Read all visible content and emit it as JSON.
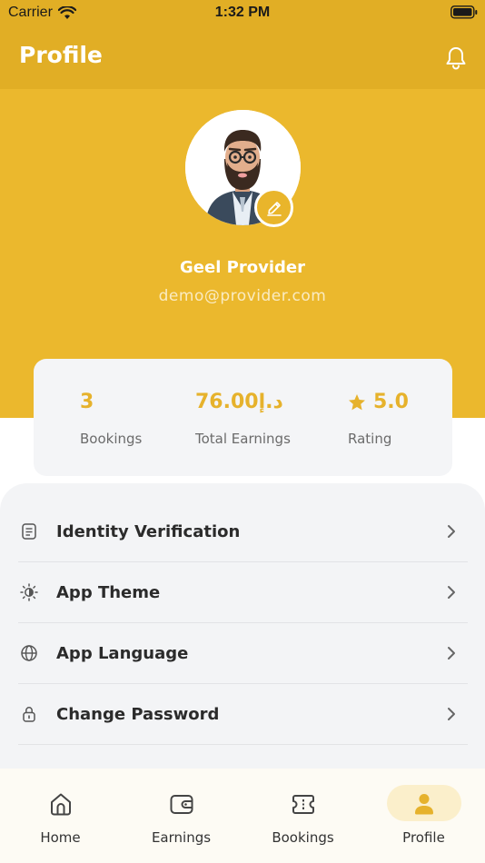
{
  "status_bar": {
    "carrier": "Carrier",
    "time": "1:32 PM"
  },
  "app_bar": {
    "title": "Profile",
    "notifications_icon": "bell-icon"
  },
  "profile": {
    "name": "Geel Provider",
    "email": "demo@provider.com",
    "avatar_icon": "avatar-illustration",
    "edit_icon": "pencil-icon"
  },
  "stats": {
    "bookings": {
      "value": "3",
      "label": "Bookings"
    },
    "earnings": {
      "value": "76.00د.إ",
      "label": "Total Earnings"
    },
    "rating": {
      "value": "5.0",
      "label": "Rating",
      "icon": "star-icon"
    }
  },
  "menu": {
    "items": [
      {
        "label": "Identity Verification",
        "icon": "document-icon"
      },
      {
        "label": "App Theme",
        "icon": "brightness-icon"
      },
      {
        "label": "App Language",
        "icon": "globe-icon"
      },
      {
        "label": "Change Password",
        "icon": "lock-icon"
      }
    ]
  },
  "bottom_nav": {
    "items": [
      {
        "label": "Home",
        "icon": "home-icon"
      },
      {
        "label": "Earnings",
        "icon": "wallet-icon"
      },
      {
        "label": "Bookings",
        "icon": "ticket-icon"
      },
      {
        "label": "Profile",
        "icon": "person-icon"
      }
    ],
    "active": "Profile"
  },
  "colors": {
    "primary": "#E1AE25",
    "header": "#EBB82D",
    "accent_text": "#E6B22C",
    "card_bg": "#F4F5F7",
    "active_pill": "#FBEFCB"
  }
}
